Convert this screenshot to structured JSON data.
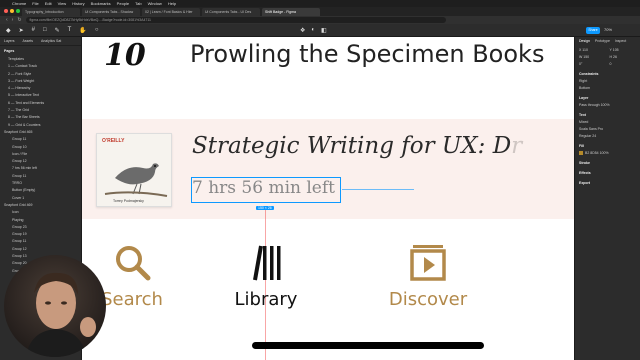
{
  "menubar": {
    "items": [
      "Chrome",
      "File",
      "Edit",
      "View",
      "History",
      "Bookmarks",
      "People",
      "Tab",
      "Window",
      "Help"
    ]
  },
  "browser": {
    "tabs": [
      {
        "label": "Typography_Introduction",
        "active": false
      },
      {
        "label": "Ui Components Tabs - Shadow",
        "active": false
      },
      {
        "label": "02 | Learn / Font Basics & Hier",
        "active": false
      },
      {
        "label": "Ui Components Tabs - UI Des",
        "active": false
      },
      {
        "label": "Shift Badge - Figma",
        "active": true
      }
    ],
    "url": "figma.com/file/OEZQdD8Z7kHy5kHdsVBwQ...-Badge?node-id=3081%3A4711"
  },
  "figma": {
    "share_label": "Share",
    "zoom": "70%",
    "left_panel": {
      "tabs": [
        "Layers",
        "Assets",
        "Analytics Sat"
      ],
      "pages_title": "Pages",
      "layers": [
        "Templates",
        "1 — Contact Track",
        "2 — Font Style",
        "3 — Font Weight",
        "4 — Hierarchy",
        "5 — Interactive Text",
        "6 — Text and Elements",
        "7 — The Grid",
        "8 — The Bar Sheets",
        "9 — Grid & Counters",
        "Snapfont Grid 465",
        "Group 11",
        "Group 10",
        "Icon / File",
        "Group 12",
        "7 hrs 56 min left",
        "Group 11",
        "TRRO",
        "Button (Empty)",
        "Cover 1",
        "Snapfont Grid 469",
        "Icon",
        "Playing",
        "Group 23",
        "Group 19",
        "Group 11",
        "Group 12",
        "Group 13",
        "Group 20",
        "Group 18"
      ]
    },
    "right_panel": {
      "tabs": [
        "Design",
        "Prototype",
        "Inspect"
      ],
      "fields": [
        "X 110",
        "Y 105",
        "W 150",
        "H 26",
        "0°",
        "0"
      ],
      "constraints_title": "Constraints",
      "constraints": [
        "Right",
        "Bottom"
      ],
      "layer_title": "Layer",
      "layer_mode": "Pass through",
      "layer_opacity": "100%",
      "text_title": "Text",
      "text_style": "Mixed",
      "font_name": "Scala Sans Pro",
      "font_weight": "Regular",
      "font_size": "24",
      "fill_title": "Fill",
      "fill_value": "B2 8D54",
      "fill_opacity": "100%",
      "stroke_title": "Stroke",
      "effects_title": "Effects",
      "export_title": "Export"
    }
  },
  "canvas": {
    "chapter_number": "10",
    "heading": "Prowling the Specimen Books",
    "book": {
      "publisher": "O'REILLY",
      "author": "Torrey Podmajersky",
      "title": "Strategic Writing for UX: D",
      "title_fade": "r",
      "time_left": "7 hrs 56 min left"
    },
    "selection_badge": "150 × 26",
    "nav": [
      {
        "label": "Search",
        "icon": "search-icon",
        "color": "#b2894a"
      },
      {
        "label": "Library",
        "icon": "library-icon",
        "color": "#111111"
      },
      {
        "label": "Discover",
        "icon": "play-icon",
        "color": "#b2894a"
      }
    ]
  },
  "colors": {
    "accent": "#0d99ff",
    "gold": "#b2894a",
    "card_bg": "#fbf0ed"
  }
}
